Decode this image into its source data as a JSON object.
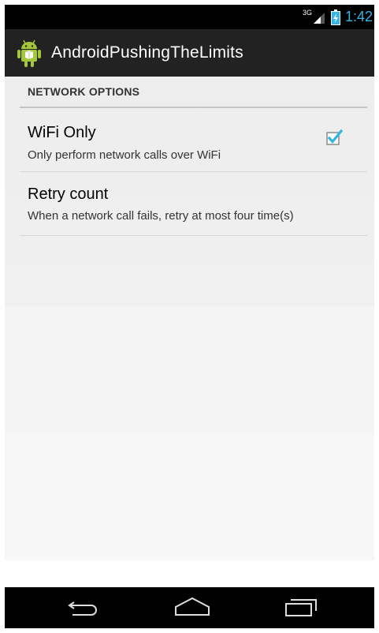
{
  "status_bar": {
    "network_type": "3G",
    "time": "1:42",
    "signal_icon": "signal-strength-icon",
    "battery_icon": "battery-charging-icon",
    "clock_color": "#33b5e5"
  },
  "action_bar": {
    "app_icon": "android-robot-icon",
    "title": "AndroidPushingTheLimits"
  },
  "preferences": {
    "section_header": "NETWORK OPTIONS",
    "wifi_only": {
      "title": "WiFi Only",
      "summary": "Only perform network calls over WiFi",
      "checked": true,
      "checkbox_color": "#33b5e5"
    },
    "retry_count": {
      "title": "Retry count",
      "summary": "When a network call fails, retry at most four time(s)"
    }
  },
  "nav_bar": {
    "back_icon": "back-icon",
    "home_icon": "home-icon",
    "recent_icon": "recent-apps-icon"
  }
}
